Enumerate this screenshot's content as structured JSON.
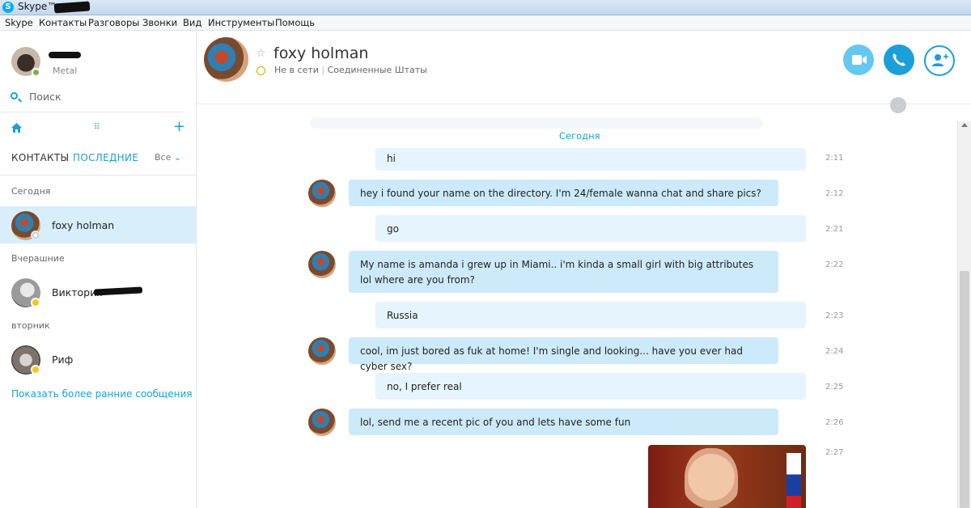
{
  "window": {
    "title": "Skype™ -"
  },
  "menu": [
    "Skype",
    "Контакты",
    "Разговоры",
    "Звонки",
    "Вид",
    "Инструменты",
    "Помощь"
  ],
  "profile": {
    "mood": "Metal",
    "status": "online"
  },
  "search": {
    "label": "Поиск"
  },
  "tabs": {
    "contacts": "КОНТАКТЫ",
    "recent": "ПОСЛЕДНИЕ",
    "filter": "Все"
  },
  "sections": {
    "today": "Сегодня",
    "yesterday": "Вчерашние",
    "tuesday": "вторник"
  },
  "contacts": [
    {
      "name": "foxy holman",
      "status": "offline"
    },
    {
      "name": "Виктория",
      "status": "away"
    },
    {
      "name": "Риф",
      "status": "away"
    }
  ],
  "show_earlier": "Показать более ранние сообщения",
  "chat": {
    "name": "foxy holman",
    "presence": "Не в сети",
    "location": "Соединенные Штаты",
    "day_label": "Сегодня",
    "messages": [
      {
        "dir": "out",
        "text": "hi",
        "time": "2:11"
      },
      {
        "dir": "in",
        "text": "hey i found your name on the directory. I'm 24/female wanna chat and share pics?",
        "time": "2:12"
      },
      {
        "dir": "out",
        "text": "go",
        "time": "2:21"
      },
      {
        "dir": "in",
        "text": "My name is amanda i grew up in Miami.. i'm kinda a small girl with big attributes lol where are you from?",
        "time": "2:22"
      },
      {
        "dir": "out",
        "text": "Russia",
        "time": "2:23"
      },
      {
        "dir": "in",
        "text": "cool, im just bored as fuk at home! I'm single and looking... have you ever had cyber sex?",
        "time": "2:24"
      },
      {
        "dir": "out",
        "text": "no, I prefer real",
        "time": "2:25"
      },
      {
        "dir": "in",
        "text": "lol, send me a recent pic of you and lets have some fun",
        "time": "2:26"
      },
      {
        "dir": "out",
        "text": "",
        "time": "2:27",
        "attachment": "photo"
      }
    ]
  },
  "colors": {
    "accent": "#1b9fd8",
    "active_row": "#d8eefa",
    "bubble_in": "#cdeafb",
    "bubble_out": "#e6f4fd"
  },
  "icons": [
    "skype-logo-icon",
    "search-icon",
    "home-icon",
    "dialpad-icon",
    "plus-icon",
    "star-icon",
    "video-call-icon",
    "call-icon",
    "add-people-icon",
    "globe-icon"
  ]
}
